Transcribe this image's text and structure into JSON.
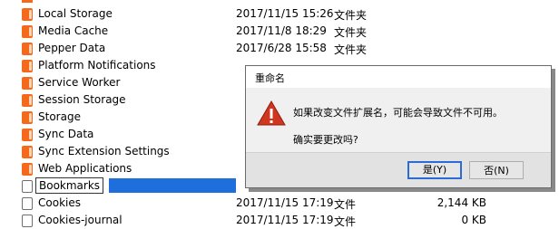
{
  "files": [
    {
      "name": "Local Storage",
      "date": "2017/11/15 15:26",
      "type": "文件夹",
      "size": "",
      "kind": "folder"
    },
    {
      "name": "Media Cache",
      "date": "2017/11/8 18:29",
      "type": "文件夹",
      "size": "",
      "kind": "folder"
    },
    {
      "name": "Pepper Data",
      "date": "2017/6/28 15:58",
      "type": "文件夹",
      "size": "",
      "kind": "folder"
    },
    {
      "name": "Platform Notifications",
      "date": "",
      "type": "",
      "size": "",
      "kind": "folder"
    },
    {
      "name": "Service Worker",
      "date": "",
      "type": "",
      "size": "",
      "kind": "folder"
    },
    {
      "name": "Session Storage",
      "date": "",
      "type": "",
      "size": "",
      "kind": "folder"
    },
    {
      "name": "Storage",
      "date": "",
      "type": "",
      "size": "",
      "kind": "folder"
    },
    {
      "name": "Sync Data",
      "date": "",
      "type": "",
      "size": "",
      "kind": "folder"
    },
    {
      "name": "Sync Extension Settings",
      "date": "",
      "type": "",
      "size": "",
      "kind": "folder"
    },
    {
      "name": "Web Applications",
      "date": "",
      "type": "",
      "size": "",
      "kind": "folder"
    },
    {
      "name": "Bookmarks",
      "date": "",
      "type": "",
      "size": "",
      "kind": "file",
      "editing": true
    },
    {
      "name": "Cookies",
      "date": "2017/11/15 17:19",
      "type": "文件",
      "size": "2,144 KB",
      "kind": "file"
    },
    {
      "name": "Cookies-journal",
      "date": "2017/11/15 17:19",
      "type": "文件",
      "size": "0 KB",
      "kind": "file"
    }
  ],
  "dialog": {
    "title": "重命名",
    "icon": "warning-icon",
    "message": "如果改变文件扩展名，可能会导致文件不可用。",
    "question": "确实要更改吗?",
    "yes_label": "是(Y)",
    "no_label": "否(N)"
  },
  "colors": {
    "folder": "#f46a1d",
    "selection": "#1e6fdc",
    "warning": "#d0361e"
  }
}
